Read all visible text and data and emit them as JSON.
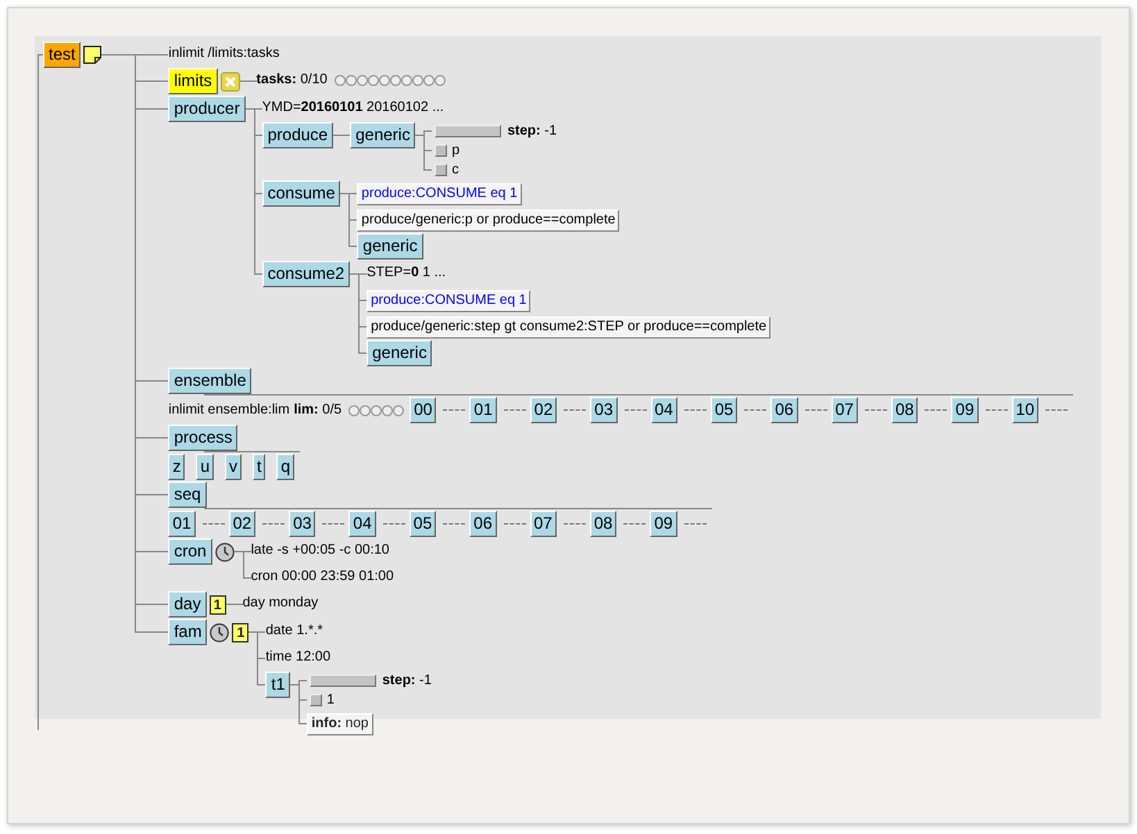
{
  "tree": {
    "kind": "node",
    "name": "test",
    "color": "#ffa500",
    "icons": [
      {
        "kind": "note"
      }
    ],
    "items": [
      {
        "kind": "inlimit",
        "text": "inlimit /limits:tasks"
      },
      {
        "kind": "node",
        "name": "limits",
        "color": "#ffff00",
        "icons": [
          {
            "kind": "cross"
          }
        ],
        "items": [
          {
            "kind": "limit",
            "text": "**tasks:** 0/10"
          }
        ]
      },
      {
        "kind": "node",
        "name": "producer",
        "color": "#add8e6",
        "items": [
          {
            "kind": "repeat",
            "text": "YMD=**20160101** 20160102 ..."
          },
          {
            "kind": "node",
            "name": "produce",
            "color": "#add8e6",
            "items": [
              {
                "kind": "node",
                "name": "generic",
                "color": "#add8e6",
                "items": [
                  {
                    "kind": "meter",
                    "text": "**step:** -1",
                    "level": 0
                  },
                  {
                    "kind": "event",
                    "name": "p",
                    "set": false
                  },
                  {
                    "kind": "event",
                    "name": "c",
                    "set": false
                  }
                ]
              }
            ]
          },
          {
            "kind": "node",
            "name": "consume",
            "color": "#add8e6",
            "items": [
              {
                "kind": "trigger",
                "text": "produce:CONSUME eq 1"
              },
              {
                "kind": "complete",
                "text": "produce/generic:p or produce==complete"
              },
              {
                "kind": "node",
                "name": "generic",
                "color": "#add8e6"
              }
            ]
          },
          {
            "kind": "node",
            "name": "consume2",
            "color": "#add8e6",
            "items": [
              {
                "kind": "repeat",
                "text": "STEP=**0** 1 ..."
              },
              {
                "kind": "trigger",
                "text": "produce:CONSUME eq 1"
              },
              {
                "kind": "complete",
                "text": "produce/generic:step gt consume2:STEP or produce==complete"
              },
              {
                "kind": "node",
                "name": "generic",
                "color": "#add8e6"
              }
            ]
          }
        ]
      },
      {
        "kind": "branch",
        "name": "ensemble",
        "color": "#add8e6",
        "items": [
          {
            "kind": "inlimit",
            "text": "inlimit ensemble:lim"
          },
          {
            "kind": "limit",
            "text": "**lim:** 0/5"
          },
          {
            "kind": "stub",
            "name": "00",
            "color": "#add8e6"
          },
          {
            "kind": "stub",
            "name": "01",
            "color": "#add8e6"
          },
          {
            "kind": "stub",
            "name": "02",
            "color": "#add8e6"
          },
          {
            "kind": "stub",
            "name": "03",
            "color": "#add8e6"
          },
          {
            "kind": "stub",
            "name": "04",
            "color": "#add8e6"
          },
          {
            "kind": "stub",
            "name": "05",
            "color": "#add8e6"
          },
          {
            "kind": "stub",
            "name": "06",
            "color": "#add8e6"
          },
          {
            "kind": "stub",
            "name": "07",
            "color": "#add8e6"
          },
          {
            "kind": "stub",
            "name": "08",
            "color": "#add8e6"
          },
          {
            "kind": "stub",
            "name": "09",
            "color": "#add8e6"
          },
          {
            "kind": "stub",
            "name": "10",
            "color": "#add8e6"
          }
        ]
      },
      {
        "kind": "branch",
        "name": "process",
        "color": "#add8e6",
        "items": [
          {
            "kind": "node",
            "name": "z",
            "color": "#add8e6"
          },
          {
            "kind": "node",
            "name": "u",
            "color": "#add8e6"
          },
          {
            "kind": "node",
            "name": "v",
            "color": "#add8e6"
          },
          {
            "kind": "node",
            "name": "t",
            "color": "#add8e6"
          },
          {
            "kind": "node",
            "name": "q",
            "color": "#add8e6"
          }
        ]
      },
      {
        "kind": "branch",
        "name": "seq",
        "color": "#add8e6",
        "items": [
          {
            "kind": "stub",
            "name": "01",
            "color": "#add8e6"
          },
          {
            "kind": "stub",
            "name": "02",
            "color": "#add8e6"
          },
          {
            "kind": "stub",
            "name": "03",
            "color": "#add8e6"
          },
          {
            "kind": "stub",
            "name": "04",
            "color": "#add8e6"
          },
          {
            "kind": "stub",
            "name": "05",
            "color": "#add8e6"
          },
          {
            "kind": "stub",
            "name": "06",
            "color": "#add8e6"
          },
          {
            "kind": "stub",
            "name": "07",
            "color": "#add8e6"
          },
          {
            "kind": "stub",
            "name": "08",
            "color": "#add8e6"
          },
          {
            "kind": "stub",
            "name": "09",
            "color": "#add8e6"
          }
        ]
      },
      {
        "kind": "node",
        "name": "cron",
        "color": "#add8e6",
        "icons": [
          {
            "kind": "clock"
          }
        ],
        "items": [
          {
            "kind": "attribute",
            "text": "late -s +00:05 -c 00:10"
          },
          {
            "kind": "attribute",
            "text": "cron 00:00 23:59 01:00"
          }
        ]
      },
      {
        "kind": "node",
        "name": "day",
        "color": "#add8e6",
        "icons": [
          {
            "kind": "date",
            "label": "1"
          }
        ],
        "items": [
          {
            "kind": "attribute",
            "text": "day monday"
          }
        ]
      },
      {
        "kind": "node",
        "name": "fam",
        "color": "#add8e6",
        "icons": [
          {
            "kind": "clock"
          },
          {
            "kind": "date",
            "label": "1"
          }
        ],
        "items": [
          {
            "kind": "attribute",
            "text": "date 1.*.*"
          },
          {
            "kind": "attribute",
            "text": "time 12:00"
          },
          {
            "kind": "node",
            "name": "t1",
            "color": "#add8e6",
            "items": [
              {
                "kind": "meter",
                "text": "**step:** -1",
                "level": 0
              },
              {
                "kind": "event",
                "name": "1",
                "set": false
              },
              {
                "kind": "label",
                "text": "**info:** nop"
              }
            ]
          }
        ]
      }
    ]
  }
}
